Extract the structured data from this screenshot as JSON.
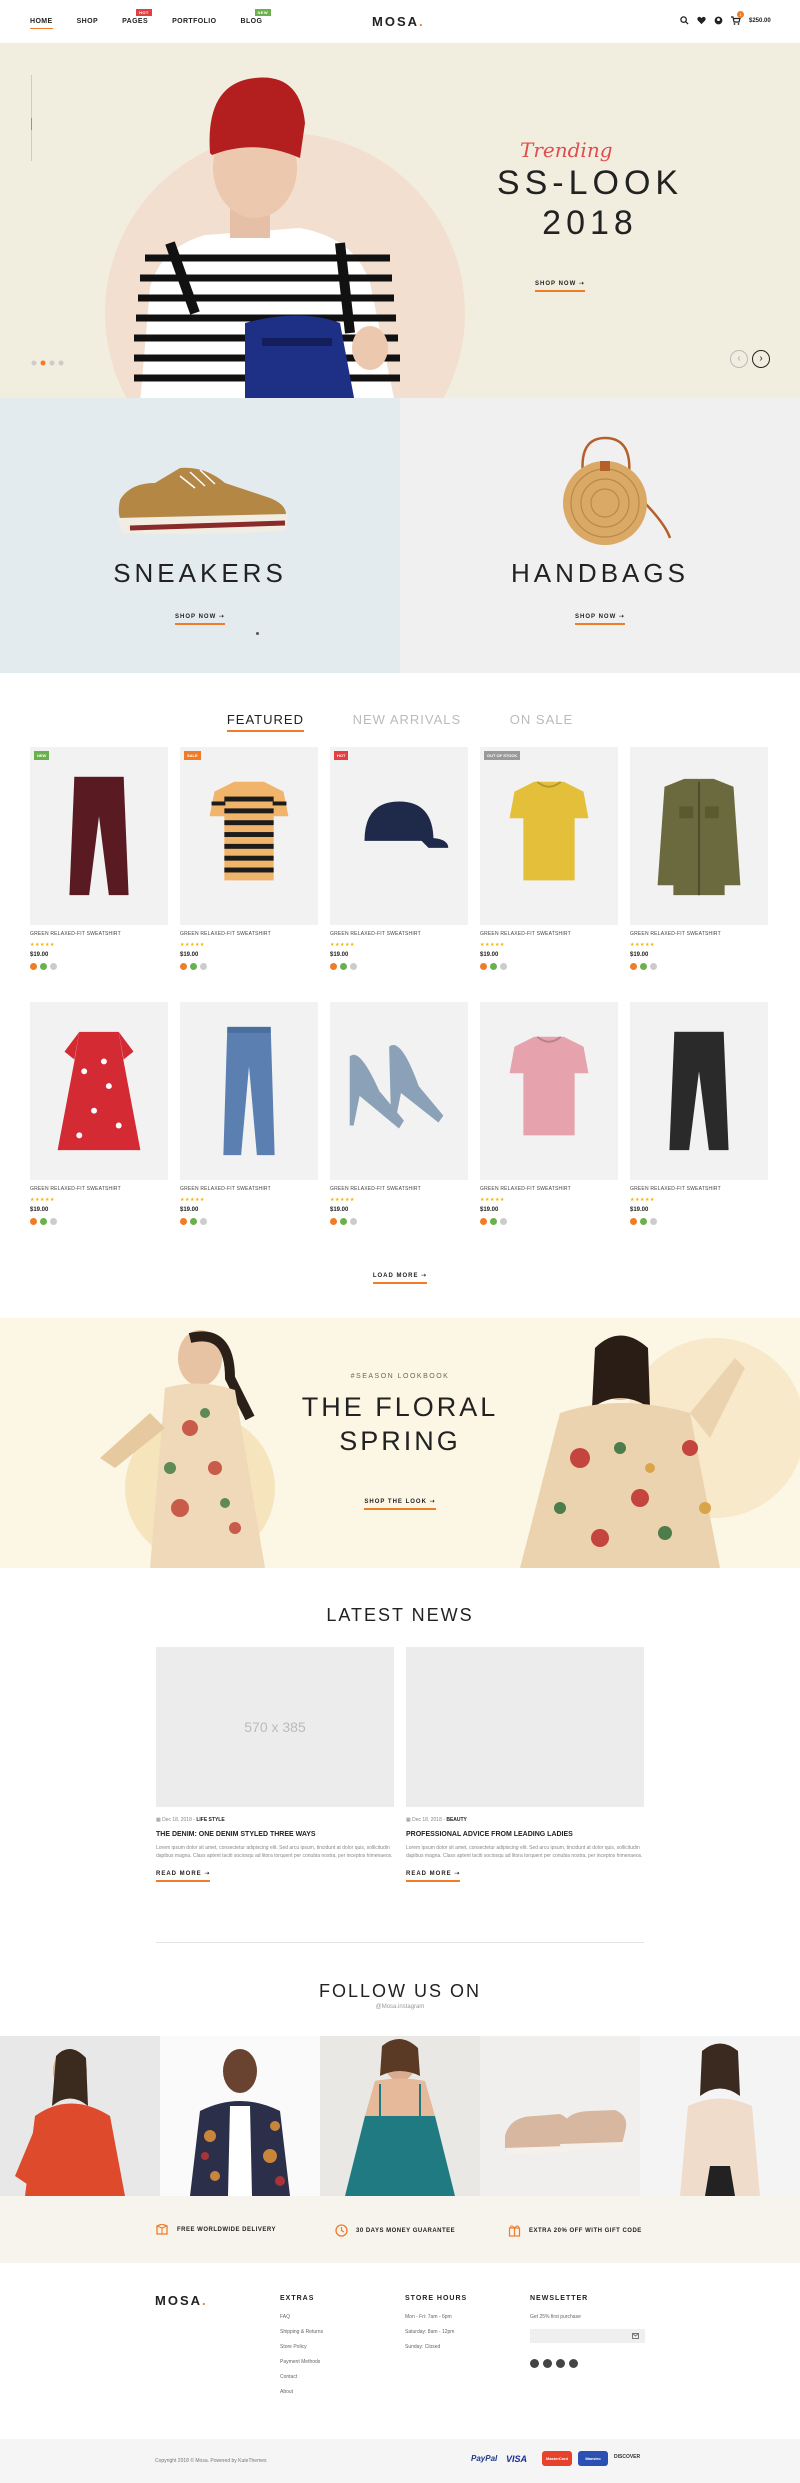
{
  "header": {
    "nav": [
      {
        "label": "HOME",
        "sub": "",
        "badge": ""
      },
      {
        "label": "SHOP",
        "badge": ""
      },
      {
        "label": "PAGES",
        "badge": "HOT"
      },
      {
        "label": "PORTFOLIO",
        "badge": ""
      },
      {
        "label": "BLOG",
        "badge": "NEW"
      }
    ],
    "logo": "MOSA",
    "cart_total": "$250.00",
    "cart_count": "1"
  },
  "hero": {
    "script": "Trending",
    "title_line1": "SS-LOOK",
    "title_line2": "2018",
    "cta": "SHOP NOW"
  },
  "banners": [
    {
      "title": "SNEAKERS",
      "cta": "SHOP NOW"
    },
    {
      "title": "HANDBAGS",
      "cta": "SHOP NOW"
    }
  ],
  "tabs": [
    "FEATURED",
    "NEW ARRIVALS",
    "ON SALE"
  ],
  "products": [
    {
      "name": "GREEN RELAXED-FIT SWEATSHIRT",
      "price": "$19.00",
      "badge": "NEW",
      "badge_color": "#6ab04c",
      "kind": "pants",
      "color": "#5a1a22"
    },
    {
      "name": "GREEN RELAXED-FIT SWEATSHIRT",
      "price": "$19.00",
      "badge": "SALE",
      "badge_color": "#f07c28",
      "kind": "tee-stripe",
      "color": "#f0b56a"
    },
    {
      "name": "GREEN RELAXED-FIT SWEATSHIRT",
      "price": "$19.00",
      "badge": "HOT",
      "badge_color": "#e04040",
      "kind": "cap",
      "color": "#1f2a4a"
    },
    {
      "name": "GREEN RELAXED-FIT SWEATSHIRT",
      "price": "$19.00",
      "badge": "OUT OF STOCK",
      "badge_color": "#9a9a9a",
      "kind": "tee",
      "color": "#e4c03a"
    },
    {
      "name": "GREEN RELAXED-FIT SWEATSHIRT",
      "price": "$19.00",
      "badge": "",
      "badge_color": "",
      "kind": "jacket",
      "color": "#6b6a3e"
    },
    {
      "name": "GREEN RELAXED-FIT SWEATSHIRT",
      "price": "$19.00",
      "badge": "",
      "badge_color": "",
      "kind": "dress",
      "color": "#d42a33"
    },
    {
      "name": "GREEN RELAXED-FIT SWEATSHIRT",
      "price": "$19.00",
      "badge": "",
      "badge_color": "",
      "kind": "jeans",
      "color": "#5a7fb0"
    },
    {
      "name": "GREEN RELAXED-FIT SWEATSHIRT",
      "price": "$19.00",
      "badge": "",
      "badge_color": "",
      "kind": "heels",
      "color": "#8aa1b8"
    },
    {
      "name": "GREEN RELAXED-FIT SWEATSHIRT",
      "price": "$19.00",
      "badge": "",
      "badge_color": "",
      "kind": "tee",
      "color": "#e6a3ad"
    },
    {
      "name": "GREEN RELAXED-FIT SWEATSHIRT",
      "price": "$19.00",
      "badge": "",
      "badge_color": "",
      "kind": "pants",
      "color": "#2a2a2a"
    }
  ],
  "stars": "★★★★★",
  "swatch_colors": [
    "#f07c28",
    "#6ab04c",
    "#cccccc"
  ],
  "load_more": "LOAD MORE",
  "lookbook": {
    "kicker": "#SEASON LOOKBOOK",
    "line1": "THE FLORAL",
    "line2": "SPRING",
    "cta": "SHOP THE LOOK"
  },
  "news": {
    "heading": "LATEST NEWS",
    "items": [
      {
        "placeholder": "570 x 385",
        "date": "Dec 18, 2018 -",
        "category": "LIFE STYLE",
        "title": "THE DENIM: ONE DENIM STYLED THREE WAYS",
        "text": "Lorem ipsum dolor sit amet, consectetur adipiscing elit. Sed arcu ipsum, tincidunt at dolor quis, sollicitudin dapibus magna. Class aptent taciti sociosqu ad litora torquent per conubia nostra, per inceptos himenaeos.",
        "cta": "READ MORE"
      },
      {
        "placeholder": "",
        "date": "Dec 18, 2018 -",
        "category": "BEAUTY",
        "title": "PROFESSIONAL ADVICE FROM LEADING LADIES",
        "text": "Lorem ipsum dolor sit amet, consectetur adipiscing elit. Sed arcu ipsum, tincidunt at dolor quis, sollicitudin dapibus magna. Class aptent taciti sociosqu ad litora torquent per conubia nostra, per inceptos himenaeos.",
        "cta": "READ MORE"
      }
    ]
  },
  "follow": {
    "heading": "FOLLOW US ON",
    "handle": "@Mosa.instagram"
  },
  "features": [
    "FREE WORLDWIDE DELIVERY",
    "30 DAYS MONEY GUARANTEE",
    "EXTRA 20% OFF WITH GIFT CODE"
  ],
  "footer": {
    "logo": "MOSA",
    "extras_title": "EXTRAS",
    "extras": [
      "FAQ",
      "Shipping & Returns",
      "Store Policy",
      "Payment Methods",
      "Contact",
      "About"
    ],
    "hours_title": "STORE HOURS",
    "hours": [
      "Mon - Fri: 7am - 6pm",
      "Saturday: 8am - 12pm",
      "Sunday: Closed"
    ],
    "newsletter_title": "NEWSLETTER",
    "newsletter_text": "Get 25% first purchase",
    "copyright": "Copyright 2018 © Mosa. Powered by KuteThemes",
    "payments": [
      "PayPal",
      "VISA",
      "MasterCard",
      "Maestro",
      "DISCOVER"
    ]
  }
}
